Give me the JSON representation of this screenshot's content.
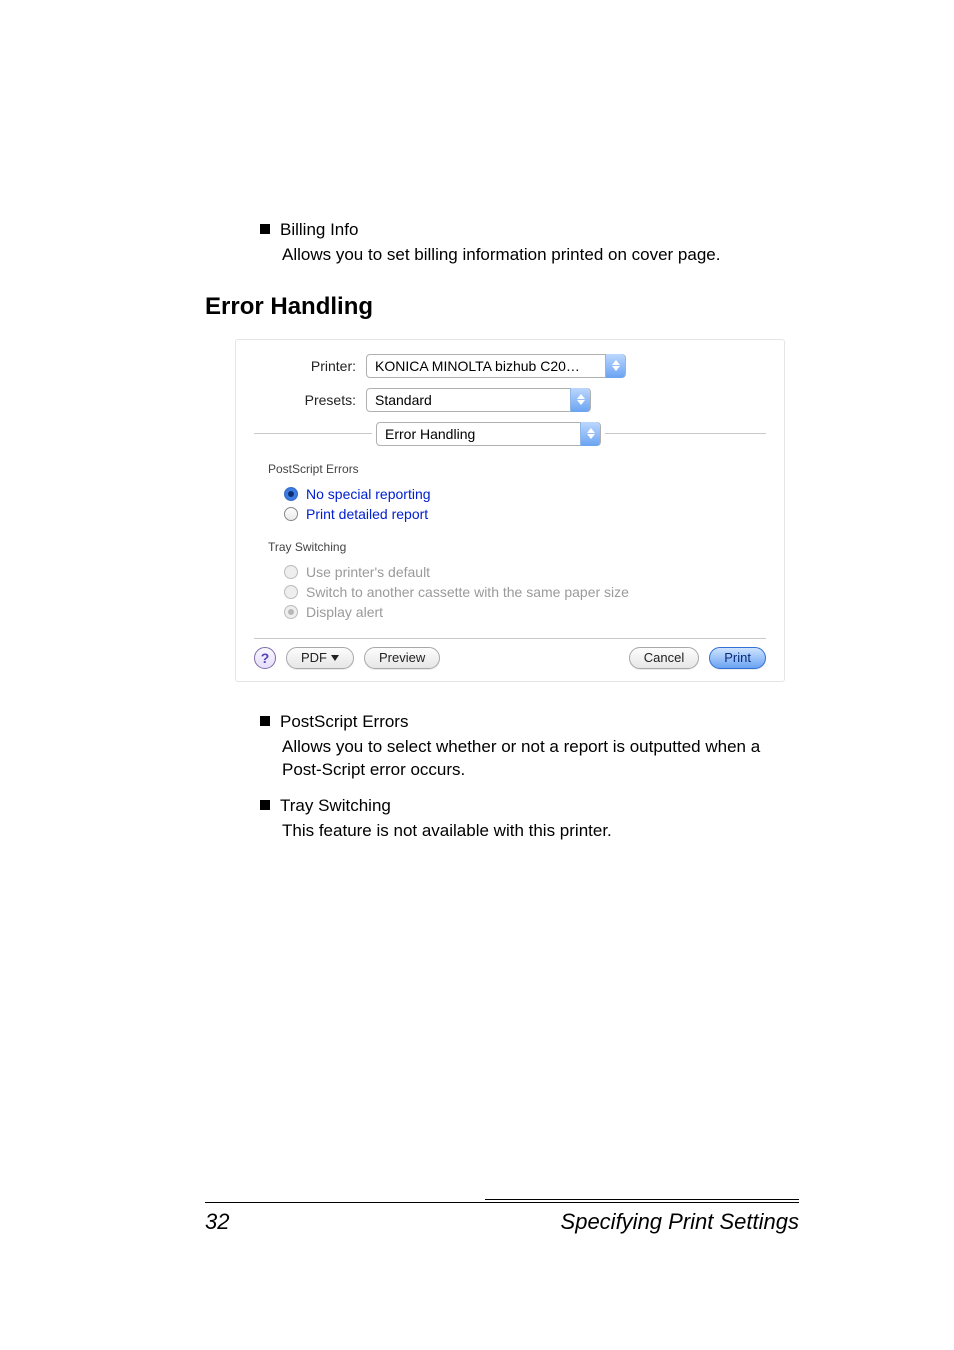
{
  "upper": {
    "bullet_title": "Billing Info",
    "bullet_desc": "Allows you to set billing information printed on cover page."
  },
  "heading": "Error Handling",
  "dialog": {
    "printer_label": "Printer:",
    "printer_value": "KONICA MINOLTA bizhub C20…",
    "presets_label": "Presets:",
    "presets_value": "Standard",
    "section_value": "Error Handling",
    "ps_group_label": "PostScript Errors",
    "ps_opt1": "No special reporting",
    "ps_opt2": "Print detailed report",
    "tray_group_label": "Tray Switching",
    "tray_opt1": "Use printer's default",
    "tray_opt2": "Switch to another cassette with the same paper size",
    "tray_opt3": "Display alert",
    "help_glyph": "?",
    "btn_pdf": "PDF ",
    "btn_preview": "Preview",
    "btn_cancel": "Cancel",
    "btn_print": "Print"
  },
  "lower": {
    "b1_title": "PostScript Errors",
    "b1_desc": "Allows you to select whether or not a report is outputted when a Post-Script error occurs.",
    "b2_title": "Tray Switching",
    "b2_desc": "This feature is not available with this printer."
  },
  "footer": {
    "page_number": "32",
    "section_title": "Specifying Print Settings"
  }
}
